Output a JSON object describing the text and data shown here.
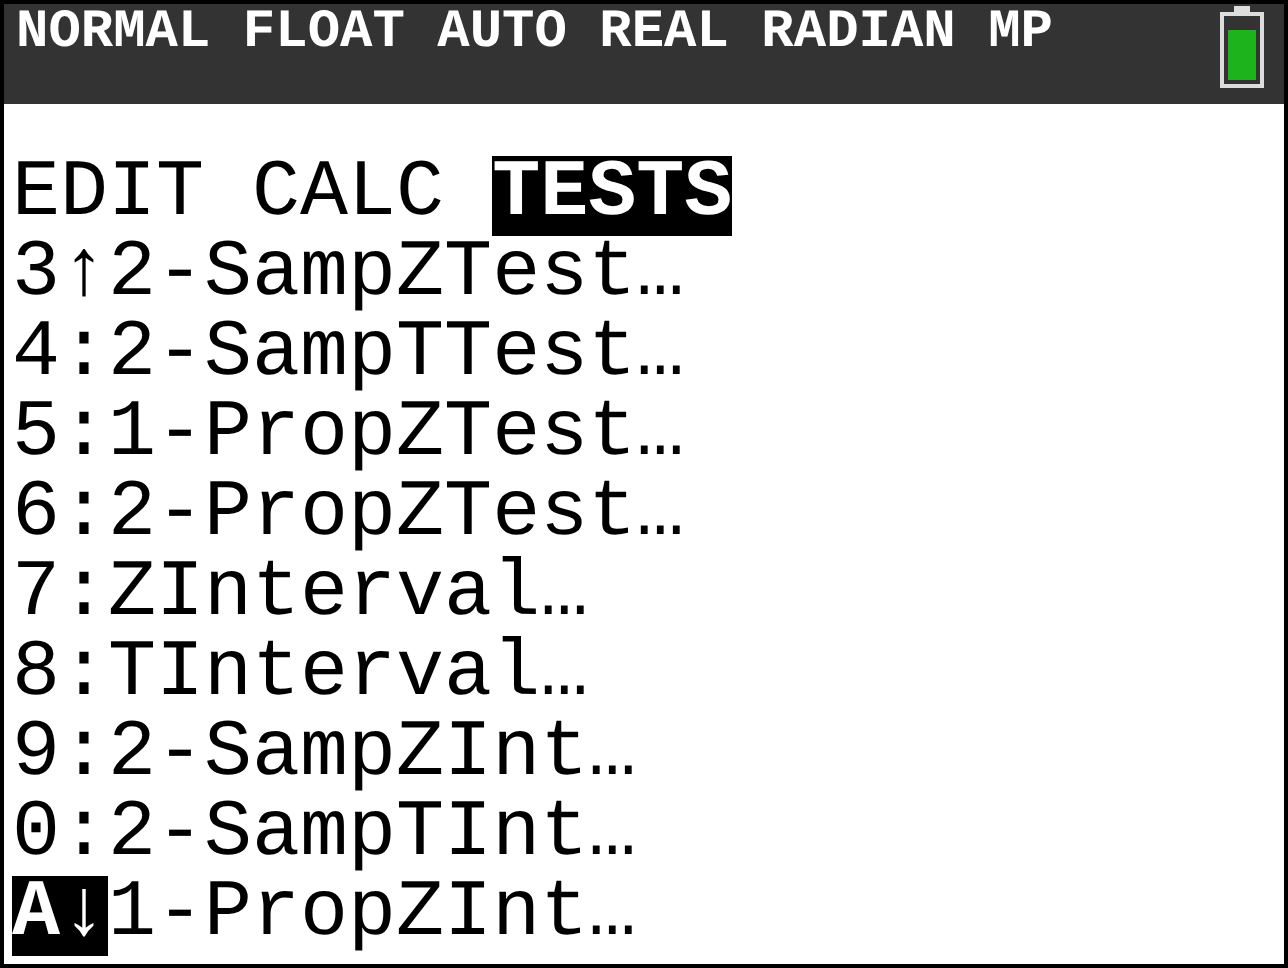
{
  "status_bar": {
    "modes": "NORMAL FLOAT AUTO REAL RADIAN MP"
  },
  "tabs": [
    {
      "label": "EDIT",
      "selected": false
    },
    {
      "label": "CALC",
      "selected": false
    },
    {
      "label": "TESTS",
      "selected": true
    }
  ],
  "items": [
    {
      "key": "3",
      "mark": "↑",
      "label": "2-SampZTest…",
      "selected": false
    },
    {
      "key": "4",
      "mark": ":",
      "label": "2-SampTTest…",
      "selected": false
    },
    {
      "key": "5",
      "mark": ":",
      "label": "1-PropZTest…",
      "selected": false
    },
    {
      "key": "6",
      "mark": ":",
      "label": "2-PropZTest…",
      "selected": false
    },
    {
      "key": "7",
      "mark": ":",
      "label": "ZInterval…",
      "selected": false
    },
    {
      "key": "8",
      "mark": ":",
      "label": "TInterval…",
      "selected": false
    },
    {
      "key": "9",
      "mark": ":",
      "label": "2-SampZInt…",
      "selected": false
    },
    {
      "key": "0",
      "mark": ":",
      "label": "2-SampTInt…",
      "selected": false
    },
    {
      "key": "A",
      "mark": "↓",
      "label": "1-PropZInt…",
      "selected": true
    }
  ]
}
